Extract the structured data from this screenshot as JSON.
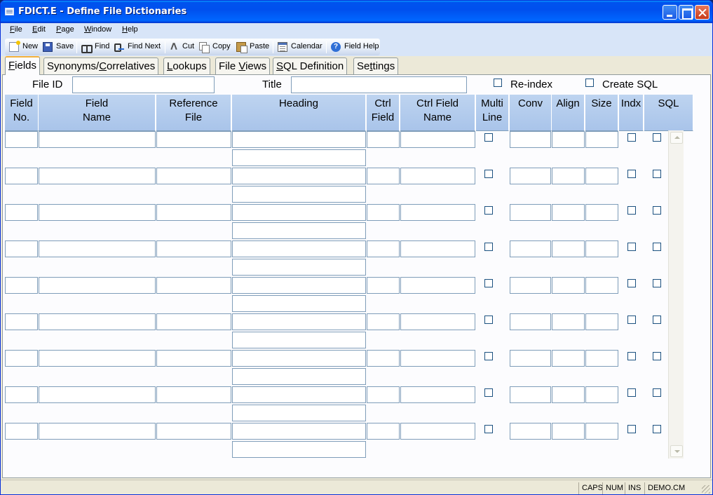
{
  "window": {
    "title": "FDICT.E - Define File Dictionaries"
  },
  "menu": [
    {
      "label": "File",
      "u": "F",
      "rest": "ile"
    },
    {
      "label": "Edit",
      "u": "E",
      "rest": "dit"
    },
    {
      "label": "Page",
      "u": "P",
      "rest": "age"
    },
    {
      "label": "Window",
      "u": "W",
      "rest": "indow"
    },
    {
      "label": "Help",
      "u": "H",
      "rest": "elp"
    }
  ],
  "toolbar": {
    "new": "New",
    "save": "Save",
    "find": "Find",
    "find_next": "Find Next",
    "cut": "Cut",
    "copy": "Copy",
    "paste": "Paste",
    "calendar": "Calendar",
    "field_help": "Field Help",
    "help_glyph": "?"
  },
  "tabs": [
    {
      "u": "F",
      "rest": "ields"
    },
    {
      "pre": "Synonyms/",
      "u": "C",
      "rest": "orrelatives"
    },
    {
      "u": "L",
      "rest": "ookups"
    },
    {
      "pre": "File ",
      "u": "V",
      "rest": "iews"
    },
    {
      "u": "S",
      "rest": "QL Definition"
    },
    {
      "pre": "Se",
      "u": "t",
      "rest": "tings"
    }
  ],
  "form": {
    "file_id_label": "File ID",
    "file_id_value": "",
    "title_label": "Title",
    "title_value": "",
    "reindex_label": "Re-index",
    "create_sql_label": "Create SQL"
  },
  "columns": [
    {
      "line1": "Field",
      "line2": "No."
    },
    {
      "line1": "Field",
      "line2": "Name"
    },
    {
      "line1": "Reference",
      "line2": "File"
    },
    {
      "line1": "Heading",
      "line2": ""
    },
    {
      "line1": "Ctrl",
      "line2": "Field"
    },
    {
      "line1": "Ctrl Field",
      "line2": "Name"
    },
    {
      "line1": "Multi",
      "line2": "Line"
    },
    {
      "line1": "Conv",
      "line2": ""
    },
    {
      "line1": "Align",
      "line2": ""
    },
    {
      "line1": "Size",
      "line2": ""
    },
    {
      "line1": "Indx",
      "line2": ""
    },
    {
      "line1": "SQL",
      "line2": ""
    }
  ],
  "status": {
    "caps": "CAPS",
    "num": "NUM",
    "ins": "INS",
    "account": "DEMO.CM"
  }
}
